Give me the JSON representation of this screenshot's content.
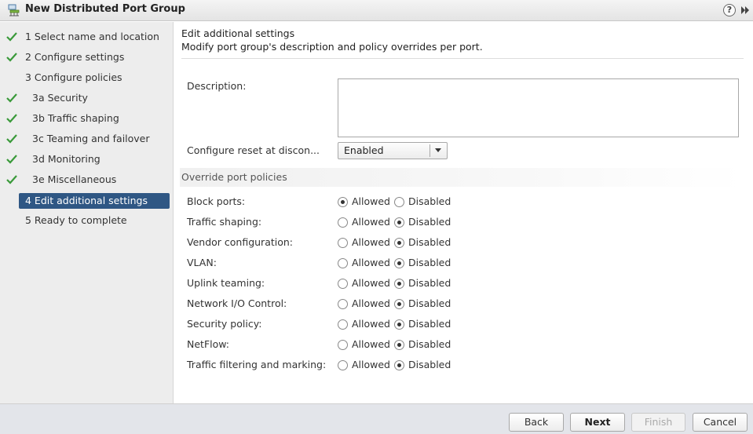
{
  "window": {
    "title": "New Distributed Port Group",
    "help_glyph": "?",
    "icons": [
      "network-port-group-icon",
      "help-icon",
      "expand-icon"
    ]
  },
  "steps": [
    {
      "label": "1  Select name and location",
      "completed": true,
      "active": false
    },
    {
      "label": "2  Configure settings",
      "completed": true,
      "active": false
    },
    {
      "label": "3  Configure policies",
      "completed": false,
      "active": false
    },
    {
      "label": "3a  Security",
      "completed": true,
      "active": false
    },
    {
      "label": "3b  Traffic shaping",
      "completed": true,
      "active": false
    },
    {
      "label": "3c  Teaming and failover",
      "completed": true,
      "active": false
    },
    {
      "label": "3d  Monitoring",
      "completed": true,
      "active": false
    },
    {
      "label": "3e  Miscellaneous",
      "completed": true,
      "active": false
    },
    {
      "label": "4  Edit additional settings",
      "completed": false,
      "active": true
    },
    {
      "label": "5  Ready to complete",
      "completed": false,
      "active": false
    }
  ],
  "header": {
    "title": "Edit additional settings",
    "subtitle": "Modify port group's description and policy overrides per port."
  },
  "form": {
    "description_label": "Description:",
    "description_value": "",
    "reset_label": "Configure reset at discon...",
    "reset_value": "Enabled"
  },
  "override": {
    "section_title": "Override port policies",
    "allowed_label": "Allowed",
    "disabled_label": "Disabled",
    "policies": [
      {
        "label": "Block ports:",
        "value": "Allowed"
      },
      {
        "label": "Traffic shaping:",
        "value": "Disabled"
      },
      {
        "label": "Vendor configuration:",
        "value": "Disabled"
      },
      {
        "label": "VLAN:",
        "value": "Disabled"
      },
      {
        "label": "Uplink teaming:",
        "value": "Disabled"
      },
      {
        "label": "Network I/O Control:",
        "value": "Disabled"
      },
      {
        "label": "Security policy:",
        "value": "Disabled"
      },
      {
        "label": "NetFlow:",
        "value": "Disabled"
      },
      {
        "label": "Traffic filtering and marking:",
        "value": "Disabled"
      }
    ]
  },
  "footer": {
    "back_label": "Back",
    "next_label": "Next",
    "finish_label": "Finish",
    "cancel_label": "Cancel"
  },
  "colors": {
    "active_step_bg": "#2f5784",
    "check_green": "#3a9a3a"
  }
}
